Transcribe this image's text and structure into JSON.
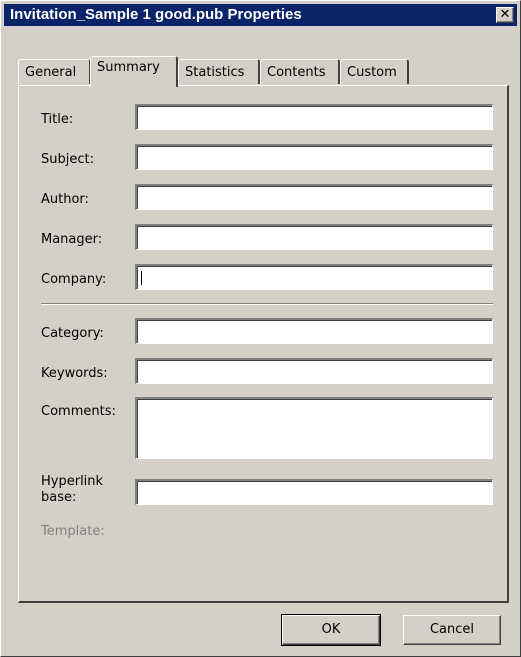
{
  "window": {
    "title": "Invitation_Sample 1 good.pub Properties",
    "close_glyph": "✕"
  },
  "tabs": [
    {
      "label": "General",
      "active": false
    },
    {
      "label": "Summary",
      "active": true
    },
    {
      "label": "Statistics",
      "active": false
    },
    {
      "label": "Contents",
      "active": false
    },
    {
      "label": "Custom",
      "active": false
    }
  ],
  "summary": {
    "title_label": "Title:",
    "title_value": "",
    "subject_label": "Subject:",
    "subject_value": "",
    "author_label": "Author:",
    "author_value": "",
    "manager_label": "Manager:",
    "manager_value": "",
    "company_label": "Company:",
    "company_value": "",
    "category_label": "Category:",
    "category_value": "",
    "keywords_label": "Keywords:",
    "keywords_value": "",
    "comments_label": "Comments:",
    "comments_value": "",
    "hyperlink_label_line1": "Hyperlink",
    "hyperlink_label_line2": "base:",
    "hyperlink_value": "",
    "template_label": "Template:"
  },
  "buttons": {
    "ok": "OK",
    "cancel": "Cancel"
  }
}
